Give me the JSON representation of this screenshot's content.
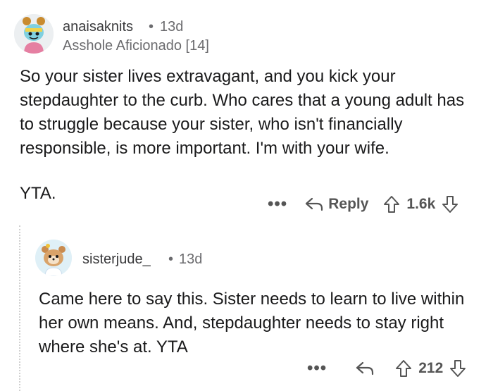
{
  "top_comment": {
    "username": "anaisaknits",
    "separator": "•",
    "age": "13d",
    "flair": "Asshole Aficionado [14]",
    "body": [
      "So your sister lives extravagant, and you kick your stepdaughter to the curb. Who cares that a young adult has to struggle because your sister, who isn't financially responsible, is more important.  I'm with your wife.",
      "YTA."
    ],
    "actions": {
      "more": "•••",
      "reply_label": "Reply",
      "score": "1.6k"
    }
  },
  "reply_comment": {
    "username": "sisterjude_",
    "separator": "•",
    "age": "13d",
    "body": "Came here to say this. Sister needs to learn to live within her own means. And, stepdaughter needs to stay right where she's at. YTA",
    "actions": {
      "more": "•••",
      "score": "212"
    }
  },
  "icons": {
    "reply": "reply-arrow-icon",
    "upvote": "upvote-arrow-icon",
    "downvote": "downvote-arrow-icon",
    "more": "more-dots-icon"
  },
  "colors": {
    "text": "#1a1a1b",
    "meta": "#6b6b6e",
    "action": "#555555",
    "thread_line": "#d0d0d0"
  }
}
